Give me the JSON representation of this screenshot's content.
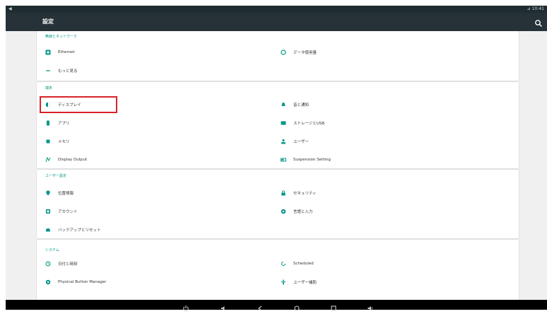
{
  "statusbar": {
    "left": "◀",
    "right": "⊿ 10:41"
  },
  "appbar": {
    "title": "設定",
    "search_icon": "search-icon"
  },
  "sections": [
    {
      "category": "無線とネットワーク",
      "items": [
        {
          "label": "Ethernet",
          "icon": "ethernet-icon"
        },
        {
          "label": "データ使用量",
          "icon": "data-usage-icon"
        },
        {
          "label": "もっと見る",
          "icon": "more-icon"
        }
      ]
    },
    {
      "category": "端末",
      "items": [
        {
          "label": "ディスプレイ",
          "icon": "display-icon"
        },
        {
          "label": "音と通知",
          "icon": "sound-icon"
        },
        {
          "label": "アプリ",
          "icon": "apps-icon"
        },
        {
          "label": "ストレージとUSB",
          "icon": "storage-icon"
        },
        {
          "label": "メモリ",
          "icon": "memory-icon"
        },
        {
          "label": "ユーザー",
          "icon": "user-icon"
        },
        {
          "label": "Display Output",
          "icon": "display-output-icon"
        },
        {
          "label": "Suspension Setting",
          "icon": "suspension-icon"
        }
      ]
    },
    {
      "category": "ユーザー設定",
      "items": [
        {
          "label": "位置情報",
          "icon": "location-icon"
        },
        {
          "label": "セキュリティ",
          "icon": "lock-icon"
        },
        {
          "label": "アカウント",
          "icon": "account-icon"
        },
        {
          "label": "言語と入力",
          "icon": "language-icon"
        },
        {
          "label": "バックアップとリセット",
          "icon": "backup-icon"
        }
      ]
    },
    {
      "category": "システム",
      "items": [
        {
          "label": "日付と時刻",
          "icon": "clock-icon"
        },
        {
          "label": "Scheduled",
          "icon": "schedule-icon"
        },
        {
          "label": "Physical Button Manager",
          "icon": "gear-icon"
        },
        {
          "label": "ユーザー補助",
          "icon": "accessibility-icon"
        }
      ]
    }
  ],
  "navbar": {
    "icons": [
      "power-icon",
      "volume-down-icon",
      "back-icon",
      "home-icon",
      "recents-icon",
      "volume-up-icon"
    ]
  },
  "colors": {
    "appbar": "#263238",
    "accent": "#009688",
    "highlight": "#d8232a",
    "background": "#f0f0f0"
  }
}
